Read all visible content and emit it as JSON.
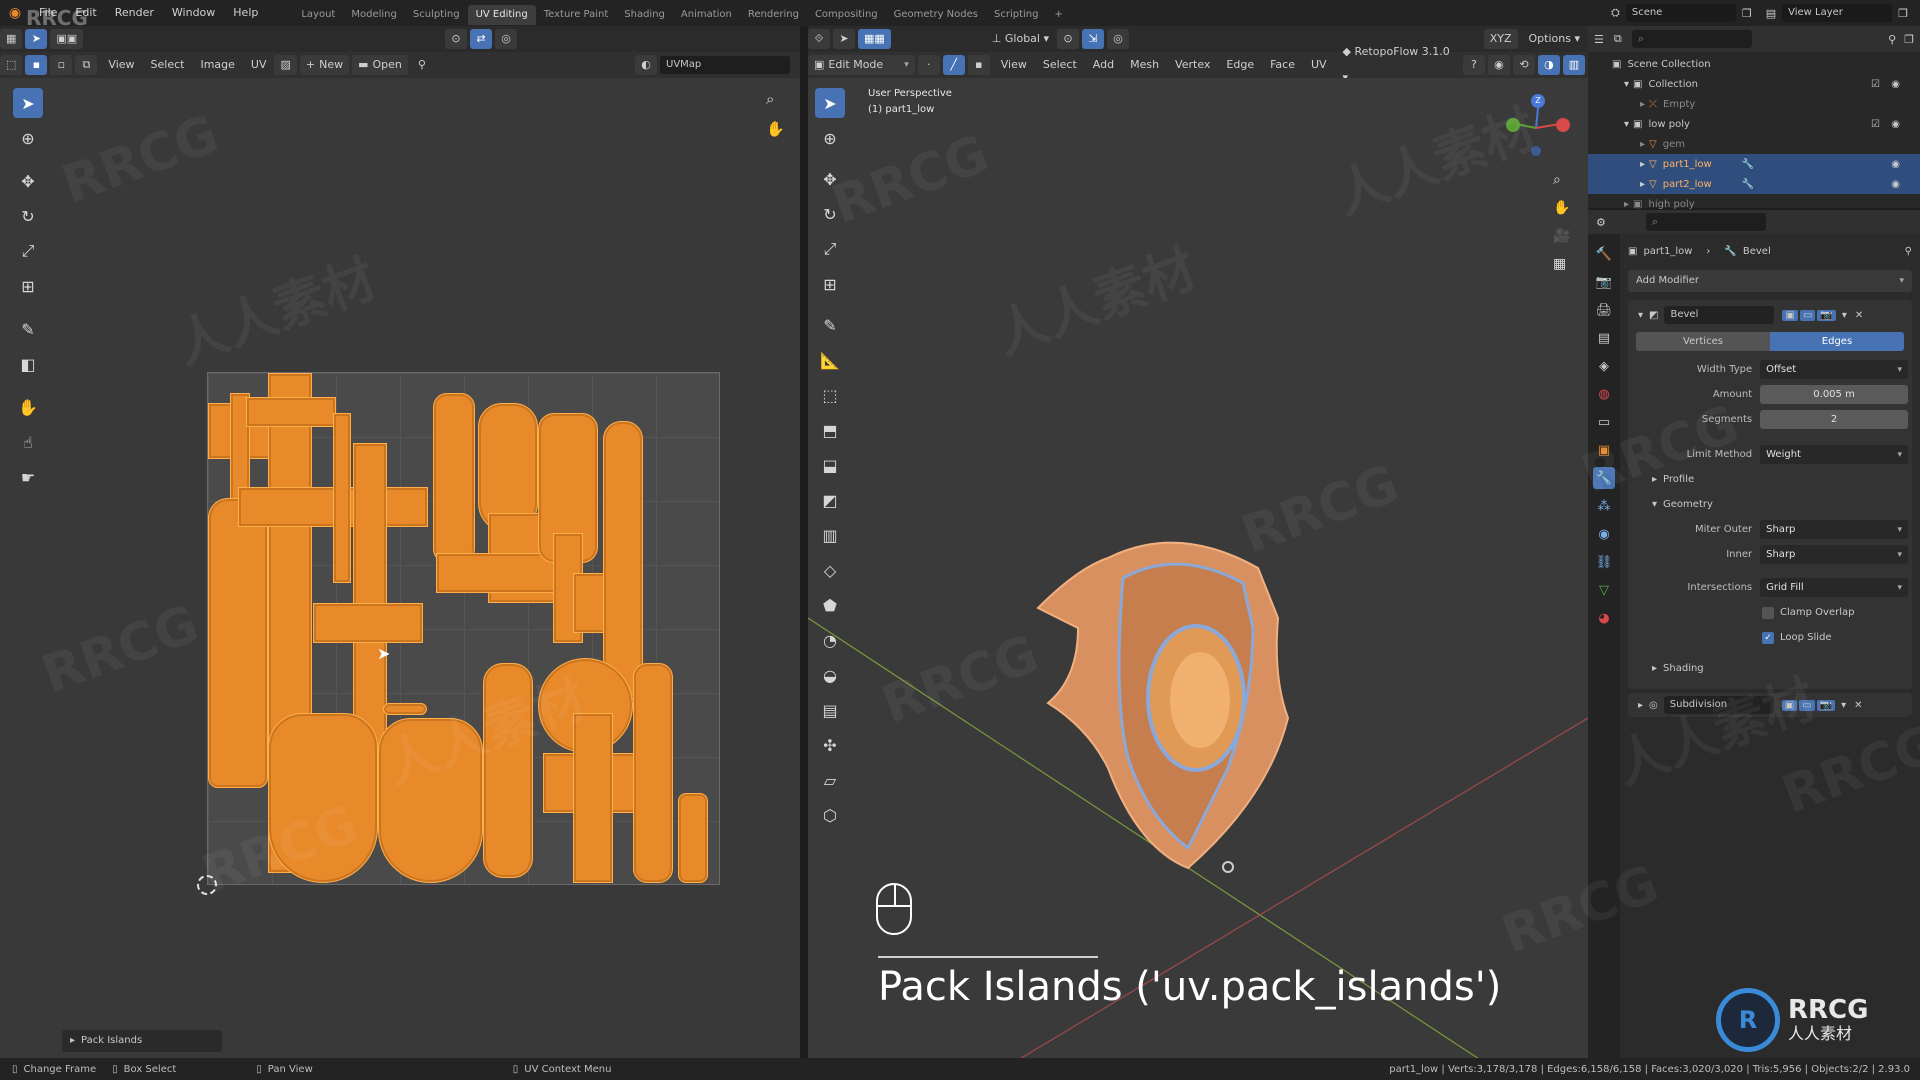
{
  "topbar": {
    "menus": [
      "File",
      "Edit",
      "Render",
      "Window",
      "Help"
    ],
    "workspaces": [
      "Layout",
      "Modeling",
      "Sculpting",
      "UV Editing",
      "Texture Paint",
      "Shading",
      "Animation",
      "Rendering",
      "Compositing",
      "Geometry Nodes",
      "Scripting"
    ],
    "active_workspace": "UV Editing",
    "scene_label": "Scene",
    "view_layer_label": "View Layer",
    "add_tab": "+"
  },
  "uv_editor": {
    "header_menus": [
      "View",
      "Select",
      "Image",
      "UV"
    ],
    "new_button": "New",
    "open_button": "Open",
    "uvmap_field": "UVMap",
    "last_op_panel": "Pack Islands"
  },
  "viewport": {
    "mode": "Edit Mode",
    "header_menus": [
      "View",
      "Select",
      "Add",
      "Mesh",
      "Vertex",
      "Edge",
      "Face",
      "UV"
    ],
    "transform_orientation": "Global",
    "addon_label": "RetopoFlow 3.1.0",
    "options_label": "Options",
    "overlay_title": "User Perspective",
    "overlay_object": "(1) part1_low",
    "operator_caption": "Pack Islands ('uv.pack_islands')"
  },
  "outliner": {
    "rows": [
      {
        "label": "Scene Collection",
        "indent": 0,
        "selected": false
      },
      {
        "label": "Collection",
        "indent": 1,
        "selected": false
      },
      {
        "label": "Empty",
        "indent": 2,
        "selected": false
      },
      {
        "label": "low poly",
        "indent": 1,
        "selected": false
      },
      {
        "label": "gem",
        "indent": 2,
        "selected": false
      },
      {
        "label": "part1_low",
        "indent": 2,
        "selected": true
      },
      {
        "label": "part2_low",
        "indent": 2,
        "selected": true
      },
      {
        "label": "high poly",
        "indent": 1,
        "selected": false
      }
    ]
  },
  "properties": {
    "object_name": "part1_low",
    "modifier_context": "Bevel",
    "add_modifier": "Add Modifier",
    "bevel": {
      "name": "Bevel",
      "tab_vertices": "Vertices",
      "tab_edges": "Edges",
      "width_type_label": "Width Type",
      "width_type_value": "Offset",
      "amount_label": "Amount",
      "amount_value": "0.005 m",
      "segments_label": "Segments",
      "segments_value": "2",
      "limit_method_label": "Limit Method",
      "limit_method_value": "Weight",
      "profile_label": "Profile",
      "geometry_label": "Geometry",
      "miter_outer_label": "Miter Outer",
      "miter_outer_value": "Sharp",
      "inner_label": "Inner",
      "inner_value": "Sharp",
      "intersections_label": "Intersections",
      "intersections_value": "Grid Fill",
      "clamp_overlap_label": "Clamp Overlap",
      "clamp_overlap_checked": false,
      "loop_slide_label": "Loop Slide",
      "loop_slide_checked": true,
      "shading_label": "Shading"
    },
    "subdivision_name": "Subdivision"
  },
  "statusbar": {
    "change_frame": "Change Frame",
    "box_select": "Box Select",
    "pan_view": "Pan View",
    "uv_context_menu": "UV Context Menu",
    "stats": "part1_low | Verts:3,178/3,178 | Edges:6,158/6,158 | Faces:3,020/3,020 | Tris:5,956 | Objects:2/2 | 2.93.0"
  },
  "watermarks": {
    "rrcg": "RRCG",
    "cn": "人人素材",
    "logo_text_en": "RRCG",
    "logo_text_cn": "人人素材"
  },
  "colors": {
    "accent": "#4772b3",
    "uv_island": "#e8892a",
    "panel_bg": "#303030"
  }
}
